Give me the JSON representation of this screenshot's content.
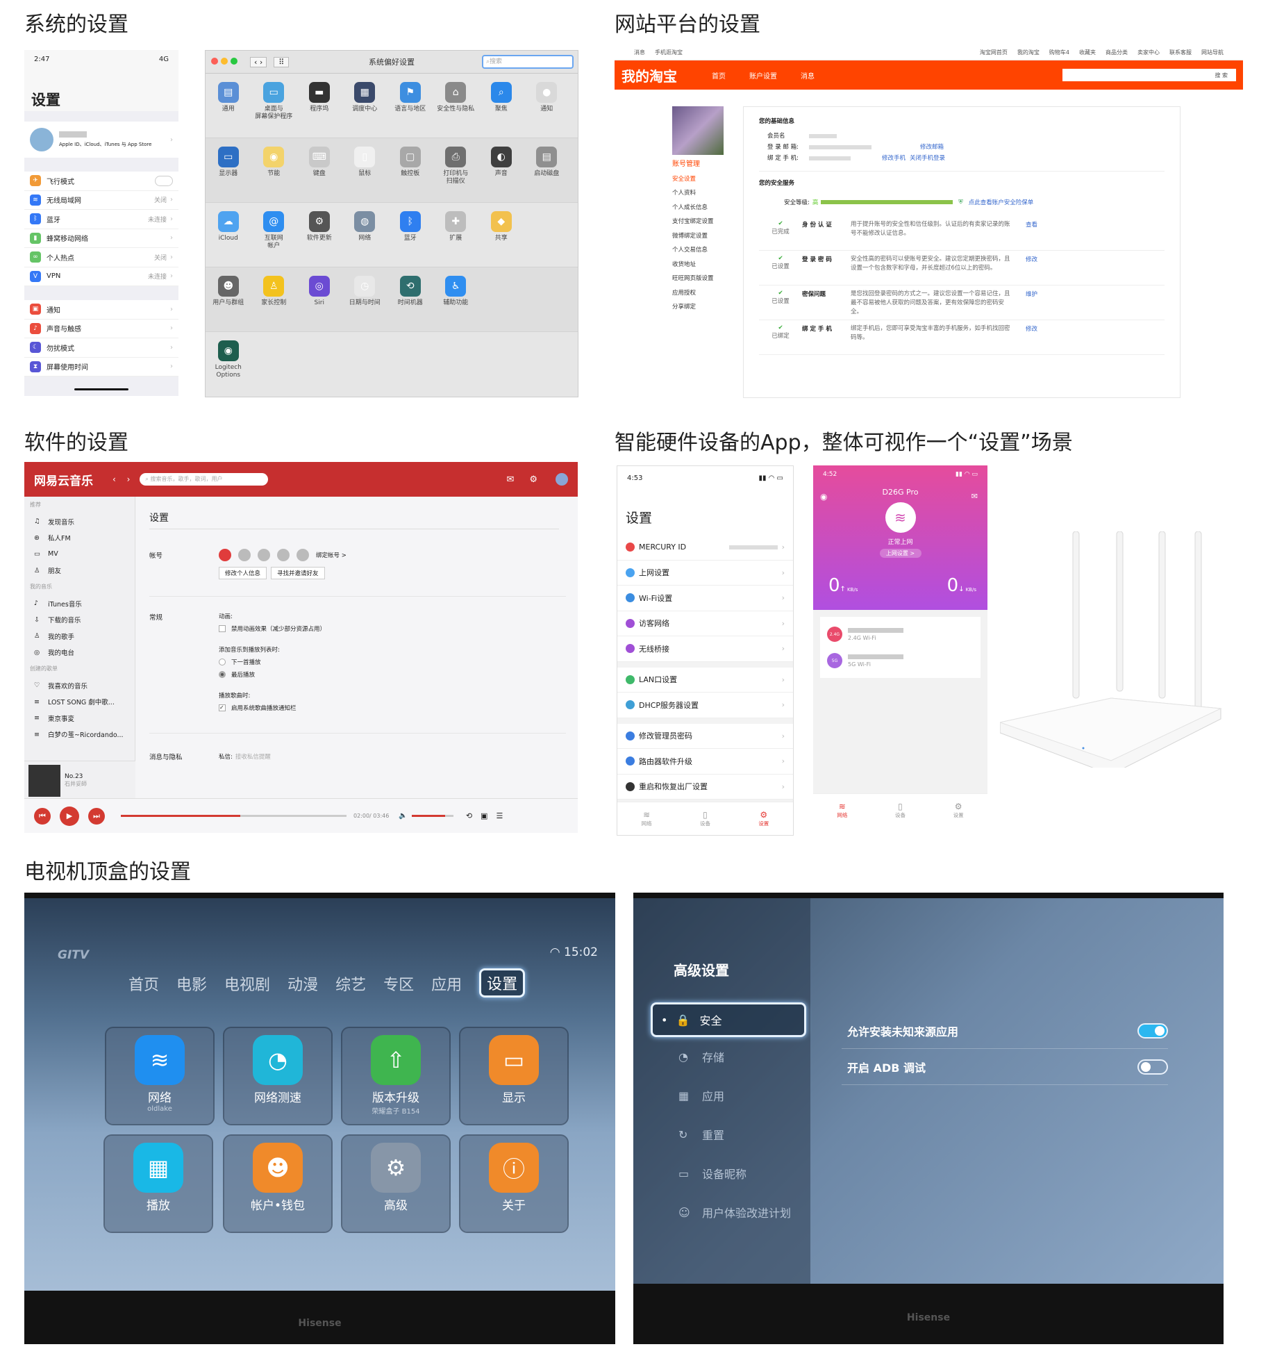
{
  "titles": {
    "system": "系统的设置",
    "website": "网站平台的设置",
    "software": "软件的设置",
    "hardware": "智能硬件设备的App，整体可视作一个“设置”场景",
    "tv": "电视机顶盒的设置"
  },
  "ios": {
    "time": "2:47",
    "signal": "4G",
    "title": "设置",
    "account_sub": "Apple ID、iCloud、iTunes 与 App Store",
    "group1": [
      {
        "label": "飞行模式",
        "value": "",
        "color": "#f19a37",
        "icon": "✈"
      },
      {
        "label": "无线局域网",
        "value": "关闭",
        "color": "#3478f6",
        "icon": "≋"
      },
      {
        "label": "蓝牙",
        "value": "未连接",
        "color": "#3478f6",
        "icon": "ᛒ"
      },
      {
        "label": "蜂窝移动网络",
        "value": "",
        "color": "#65c466",
        "icon": "▮"
      },
      {
        "label": "个人热点",
        "value": "关闭",
        "color": "#65c466",
        "icon": "∞"
      },
      {
        "label": "VPN",
        "value": "未连接",
        "color": "#3478f6",
        "icon": "V"
      }
    ],
    "group2": [
      {
        "label": "通知",
        "color": "#eb4d3d",
        "icon": "▣"
      },
      {
        "label": "声音与触感",
        "color": "#eb4d3d",
        "icon": "♪"
      },
      {
        "label": "勿扰模式",
        "color": "#5856d6",
        "icon": "☾"
      },
      {
        "label": "屏幕使用时间",
        "color": "#5856d6",
        "icon": "⧗"
      }
    ]
  },
  "mac": {
    "title": "系统偏好设置",
    "search_placeholder": "搜索",
    "rows": [
      [
        {
          "label": "通用",
          "color": "#5a8fd6",
          "icon": "▤"
        },
        {
          "label": "桌面与\n屏幕保护程序",
          "color": "#4aa3df",
          "icon": "▭"
        },
        {
          "label": "程序坞",
          "color": "#333333",
          "icon": "▬"
        },
        {
          "label": "调度中心",
          "color": "#3b4a6b",
          "icon": "▦"
        },
        {
          "label": "语言与地区",
          "color": "#3d8ee0",
          "icon": "⚑"
        },
        {
          "label": "安全性与隐私",
          "color": "#8a8a8a",
          "icon": "⌂"
        },
        {
          "label": "聚焦",
          "color": "#2b88ea",
          "icon": "⌕"
        },
        {
          "label": "通知",
          "color": "#d9d9d9",
          "icon": "●"
        }
      ],
      [
        {
          "label": "显示器",
          "color": "#2d6fc4",
          "icon": "▭"
        },
        {
          "label": "节能",
          "color": "#f3d36b",
          "icon": "◉"
        },
        {
          "label": "键盘",
          "color": "#c9c9c9",
          "icon": "⌨"
        },
        {
          "label": "鼠标",
          "color": "#f0f0f0",
          "icon": "▯"
        },
        {
          "label": "触控板",
          "color": "#a8a8a8",
          "icon": "▢"
        },
        {
          "label": "打印机与\n扫描仪",
          "color": "#6f6f6f",
          "icon": "⎙"
        },
        {
          "label": "声音",
          "color": "#3f3f3f",
          "icon": "◐"
        },
        {
          "label": "启动磁盘",
          "color": "#8f8f8f",
          "icon": "▤"
        }
      ],
      [
        {
          "label": "iCloud",
          "color": "#4fa3f0",
          "icon": "☁"
        },
        {
          "label": "互联网\n帐户",
          "color": "#2f8ef0",
          "icon": "@"
        },
        {
          "label": "软件更新",
          "color": "#555555",
          "icon": "⚙"
        },
        {
          "label": "网络",
          "color": "#7b8ea3",
          "icon": "◍"
        },
        {
          "label": "蓝牙",
          "color": "#2f7ff0",
          "icon": "ᛒ"
        },
        {
          "label": "扩展",
          "color": "#bdbdbd",
          "icon": "✚"
        },
        {
          "label": "共享",
          "color": "#f2c14e",
          "icon": "◆"
        }
      ],
      [
        {
          "label": "用户与群组",
          "color": "#666666",
          "icon": "☻"
        },
        {
          "label": "家长控制",
          "color": "#f3c21e",
          "icon": "♙"
        },
        {
          "label": "Siri",
          "color": "#6b4bd3",
          "icon": "◎"
        },
        {
          "label": "日期与时间",
          "color": "#e8e8e8",
          "icon": "◷"
        },
        {
          "label": "时间机器",
          "color": "#2e6e6e",
          "icon": "⟲"
        },
        {
          "label": "辅助功能",
          "color": "#2f8ef0",
          "icon": "♿"
        }
      ],
      [
        {
          "label": "Logitech Options",
          "color": "#1e5e4e",
          "icon": "◉"
        }
      ]
    ]
  },
  "taobao": {
    "top_left": [
      "消息",
      "手机逛淘宝"
    ],
    "top_right": [
      "淘宝网首页",
      "我的淘宝",
      "购物车4",
      "收藏夹",
      "商品分类",
      "卖家中心",
      "联系客服",
      "网站导航"
    ],
    "logo": "我的淘宝",
    "nav": [
      "首页",
      "账户设置",
      "消息"
    ],
    "search_btn": "搜 索",
    "side_title": "账号管理",
    "side": [
      "安全设置",
      "个人资料",
      "个人成长信息",
      "支付宝绑定设置",
      "微博绑定设置",
      "个人交易信息",
      "收货地址",
      "旺旺网页版设置",
      "应用授权",
      "分享绑定"
    ],
    "basic_title": "您的基础信息",
    "basic_fields": [
      "会员名",
      "登 录 邮 箱:",
      "绑 定 手 机:"
    ],
    "basic_links": [
      "修改邮箱",
      "修改手机",
      "关闭手机登录"
    ],
    "safe_title": "您的安全服务",
    "level_label": "安全等级:",
    "level_value": "高",
    "level_fill": 1.0,
    "level_link": "点此查看账户安全险保单",
    "services": [
      {
        "status": "已完成",
        "name": "身 份 认 证",
        "desc": "用于提升账号的安全性和信任级别。认证后的有卖家记录的账号不能修改认证信息。",
        "action": "查看"
      },
      {
        "status": "已设置",
        "name": "登 录 密 码",
        "desc": "安全性高的密码可以使账号更安全。建议您定期更换密码，且设置一个包含数字和字母，并长度超过6位以上的密码。",
        "action": "修改"
      },
      {
        "status": "已设置",
        "name": "密保问题",
        "desc": "是您找回登录密码的方式之一。建议您设置一个容易记住，且最不容易被他人获取的问题及答案，更有效保障您的密码安全。",
        "action": "维护"
      },
      {
        "status": "已绑定",
        "name": "绑 定 手 机",
        "desc": "绑定手机后，您即可享受淘宝丰富的手机服务，如手机找回密码等。",
        "action": "修改"
      }
    ]
  },
  "netease": {
    "logo": "网易云音乐",
    "search_placeholder": "搜索音乐，歌手，歌词，用户",
    "side_sections": [
      {
        "caption": "推荐",
        "items": [
          "发现音乐",
          "私人FM",
          "MV",
          "朋友"
        ]
      },
      {
        "caption": "我的音乐",
        "items": [
          "iTunes音乐",
          "下载的音乐",
          "我的歌手",
          "我的电台"
        ]
      },
      {
        "caption": "创建的歌单",
        "items": [
          "我喜欢的音乐",
          "LOST SONG 劇中歌...",
          "東京事変",
          "白梦の茧~Ricordando..."
        ]
      }
    ],
    "now_playing": {
      "title": "No.23",
      "artist": "石井妥師"
    },
    "settings_title": "设置",
    "account_label": "帐号",
    "bind_link": "绑定帐号 >",
    "btn_edit": "修改个人信息",
    "btn_invite": "寻找并邀请好友",
    "general_label": "常规",
    "anim_label": "动画:",
    "anim_option": "禁用动画效果（减少部分资源占用）",
    "add_label": "添加音乐到播放列表时:",
    "add_options": [
      "下一首播放",
      "最后播放"
    ],
    "lyric_label": "播放歌曲时:",
    "lyric_option": "启用系统歌曲播放通知栏",
    "privacy_label": "消息与隐私",
    "privacy_sub": "私信:",
    "privacy_value": "接收私信提醒",
    "time": "02:00/ 03:46",
    "progress": 0.53,
    "volume": 0.8
  },
  "router1": {
    "time": "4:53",
    "title": "设置",
    "groups": [
      [
        {
          "label": "MERCURY ID",
          "color": "#e94848"
        },
        {
          "label": "上网设置",
          "color": "#4aa3f0"
        },
        {
          "label": "Wi-Fi设置",
          "color": "#3b8de0"
        },
        {
          "label": "访客网络",
          "color": "#a04fd6"
        },
        {
          "label": "无线桥接",
          "color": "#a04fd6"
        }
      ],
      [
        {
          "label": "LAN口设置",
          "color": "#3fb96a"
        },
        {
          "label": "DHCP服务器设置",
          "color": "#3f9fd6"
        }
      ],
      [
        {
          "label": "修改管理员密码",
          "color": "#3b7de0"
        },
        {
          "label": "路由器软件升级",
          "color": "#3b7de0"
        },
        {
          "label": "重启和恢复出厂设置",
          "color": "#333333"
        }
      ]
    ],
    "tabs": [
      "网络",
      "设备",
      "设置"
    ]
  },
  "router2": {
    "time": "4:52",
    "device": "D26G Pro",
    "status": "正常上网",
    "net_btn": "上网设置 >",
    "up_value": "0",
    "down_value": "0",
    "unit": "KB/s",
    "wifi": [
      {
        "badge": "2.4G",
        "label": "2.4G Wi-Fi",
        "color": "#e94b6b"
      },
      {
        "badge": "5G",
        "label": "5G Wi-Fi",
        "color": "#a867e0"
      }
    ],
    "tabs": [
      "网络",
      "设备",
      "设置"
    ]
  },
  "tv1": {
    "brand": "GITV",
    "time": "15:02",
    "nav": [
      "首页",
      "电影",
      "电视剧",
      "动漫",
      "综艺",
      "专区",
      "应用",
      "设置"
    ],
    "tiles": [
      {
        "label": "网络",
        "sub": "oldlake",
        "color": "#1f8ff0",
        "icon": "≋"
      },
      {
        "label": "网络测速",
        "sub": "",
        "color": "#20b6d8",
        "icon": "◔"
      },
      {
        "label": "版本升级",
        "sub": "荣耀盒子 B154",
        "color": "#3fb54f",
        "icon": "⇧"
      },
      {
        "label": "显示",
        "sub": "",
        "color": "#f08a2a",
        "icon": "▭"
      },
      {
        "label": "播放",
        "sub": "",
        "color": "#19b8e6",
        "icon": "▦"
      },
      {
        "label": "帐户•钱包",
        "sub": "",
        "color": "#f08a2a",
        "icon": "☻"
      },
      {
        "label": "高级",
        "sub": "",
        "color": "#8796a8",
        "icon": "⚙"
      },
      {
        "label": "关于",
        "sub": "",
        "color": "#f08a2a",
        "icon": "ⓘ"
      }
    ],
    "bezel": "Hisense"
  },
  "tv2": {
    "title": "高级设置",
    "menu": [
      {
        "label": "安全",
        "icon": "🔒"
      },
      {
        "label": "存储",
        "icon": "◔"
      },
      {
        "label": "应用",
        "icon": "▦"
      },
      {
        "label": "重置",
        "icon": "↻"
      },
      {
        "label": "设备昵称",
        "icon": "▭"
      },
      {
        "label": "用户体验改进计划",
        "icon": "☺"
      }
    ],
    "options": [
      {
        "label": "允许安装未知来源应用",
        "on": true
      },
      {
        "label": "开启 ADB 调试",
        "on": false
      }
    ],
    "bezel": "Hisense"
  }
}
